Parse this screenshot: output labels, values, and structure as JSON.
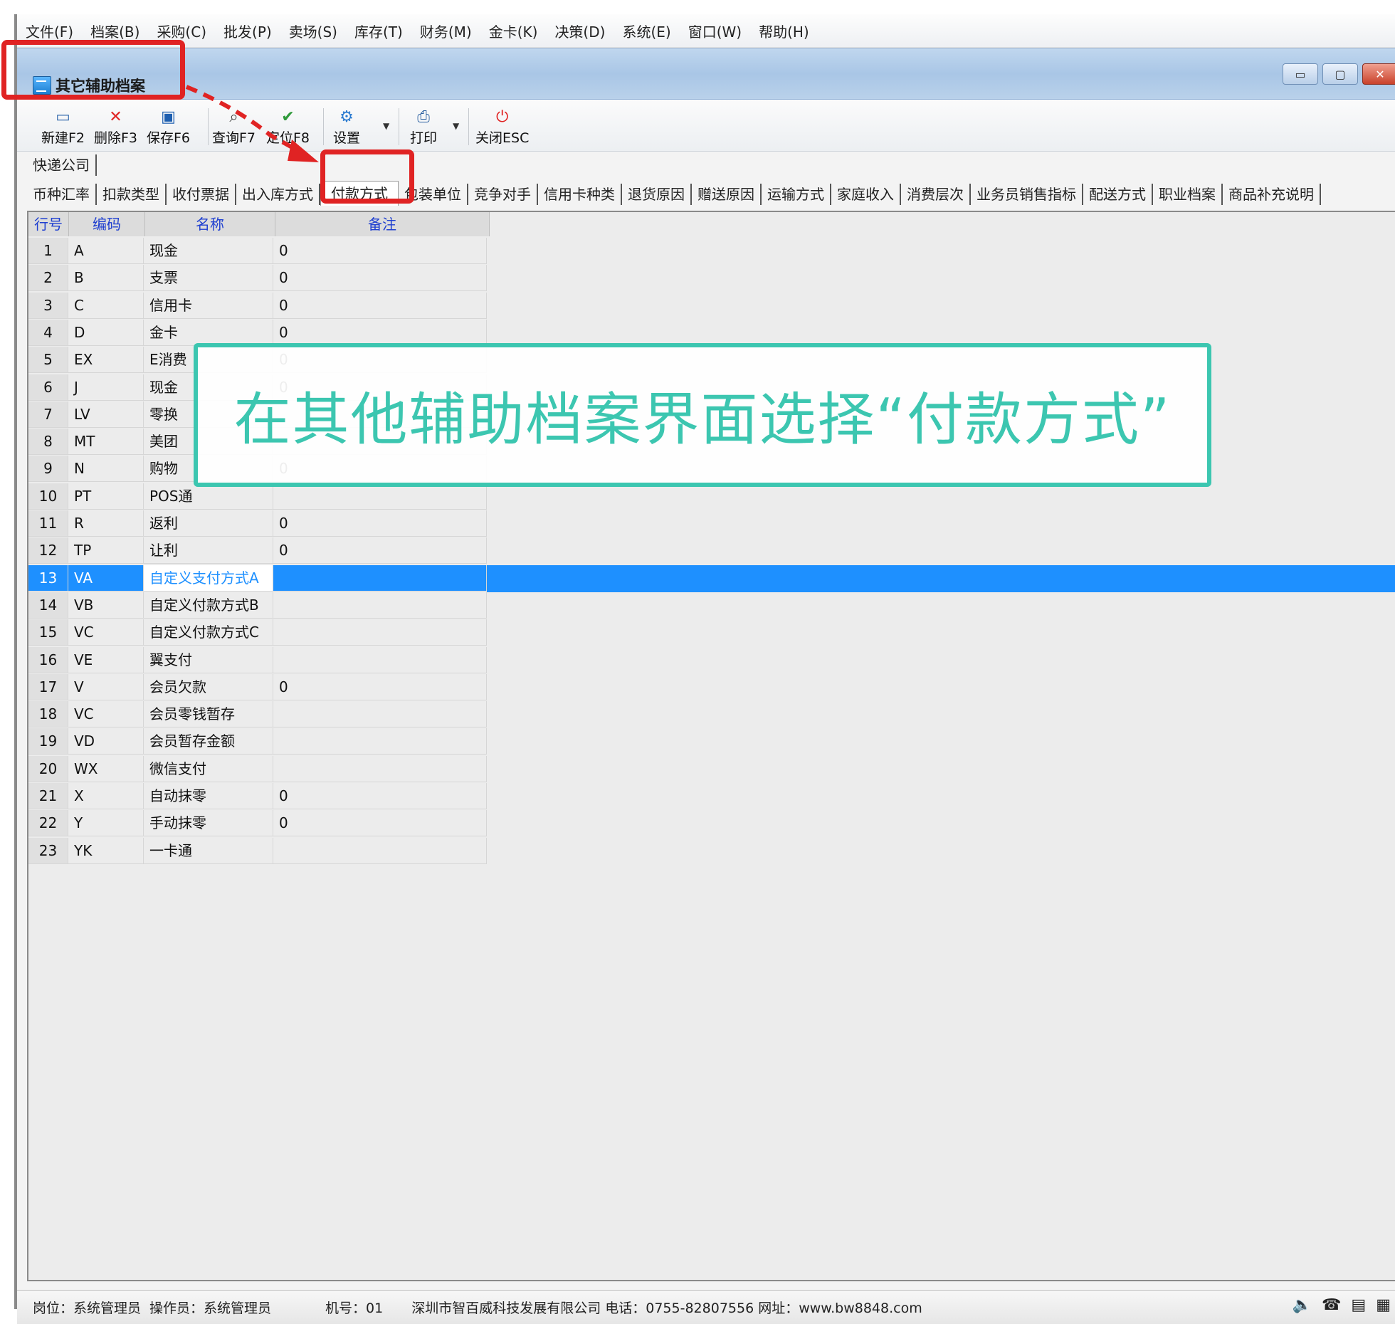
{
  "menubar": {
    "items": [
      "文件(F)",
      "档案(B)",
      "采购(C)",
      "批发(P)",
      "卖场(S)",
      "库存(T)",
      "财务(M)",
      "金卡(K)",
      "决策(D)",
      "系统(E)",
      "窗口(W)",
      "帮助(H)"
    ]
  },
  "window": {
    "title": "其它辅助档案",
    "minimize_icon": "minimize-icon",
    "maximize_icon": "maximize-icon",
    "close_icon": "close-icon"
  },
  "toolbar": {
    "new_label": "新建F2",
    "delete_label": "删除F3",
    "save_label": "保存F6",
    "query_label": "查询F7",
    "locate_label": "定位F8",
    "settings_label": "设置",
    "print_label": "打印",
    "close_label": "关闭ESC"
  },
  "tabs_row1": [
    "快递公司"
  ],
  "tabs_row2": [
    "币种汇率",
    "扣款类型",
    "收付票据",
    "出入库方式",
    "付款方式",
    "包装单位",
    "竞争对手",
    "信用卡种类",
    "退货原因",
    "赠送原因",
    "运输方式",
    "家庭收入",
    "消费层次",
    "业务员销售指标",
    "配送方式",
    "职业档案",
    "商品补充说明"
  ],
  "active_tab": "付款方式",
  "grid": {
    "headers": {
      "row_no": "行号",
      "code": "编码",
      "name": "名称",
      "note": "备注"
    },
    "rows": [
      {
        "no": "1",
        "code": "A",
        "name": "现金",
        "note": "0"
      },
      {
        "no": "2",
        "code": "B",
        "name": "支票",
        "note": "0"
      },
      {
        "no": "3",
        "code": "C",
        "name": "信用卡",
        "note": "0"
      },
      {
        "no": "4",
        "code": "D",
        "name": "金卡",
        "note": "0"
      },
      {
        "no": "5",
        "code": "EX",
        "name": "E消费",
        "note": "0"
      },
      {
        "no": "6",
        "code": "J",
        "name": "现金",
        "note": "0"
      },
      {
        "no": "7",
        "code": "LV",
        "name": "零换",
        "note": ""
      },
      {
        "no": "8",
        "code": "MT",
        "name": "美团",
        "note": ""
      },
      {
        "no": "9",
        "code": "N",
        "name": "购物",
        "note": "0"
      },
      {
        "no": "10",
        "code": "PT",
        "name": "POS通",
        "note": ""
      },
      {
        "no": "11",
        "code": "R",
        "name": "返利",
        "note": "0"
      },
      {
        "no": "12",
        "code": "TP",
        "name": "让利",
        "note": "0"
      },
      {
        "no": "13",
        "code": "VA",
        "name": "自定义支付方式A",
        "note": ""
      },
      {
        "no": "14",
        "code": "VB",
        "name": "自定义付款方式B",
        "note": ""
      },
      {
        "no": "15",
        "code": "VC",
        "name": "自定义付款方式C",
        "note": ""
      },
      {
        "no": "16",
        "code": "VE",
        "name": "翼支付",
        "note": ""
      },
      {
        "no": "17",
        "code": "V",
        "name": "会员欠款",
        "note": "0"
      },
      {
        "no": "18",
        "code": "VC",
        "name": "会员零钱暂存",
        "note": ""
      },
      {
        "no": "19",
        "code": "VD",
        "name": "会员暂存金额",
        "note": ""
      },
      {
        "no": "20",
        "code": "WX",
        "name": "微信支付",
        "note": ""
      },
      {
        "no": "21",
        "code": "X",
        "name": "自动抹零",
        "note": "0"
      },
      {
        "no": "22",
        "code": "Y",
        "name": "手动抹零",
        "note": "0"
      },
      {
        "no": "23",
        "code": "YK",
        "name": "一卡通",
        "note": ""
      }
    ],
    "selected_row": 13
  },
  "callout": {
    "text": "在其他辅助档案界面选择“付款方式”"
  },
  "statusbar": {
    "position": "岗位：系统管理员",
    "operator": "操作员：系统管理员",
    "machine": "机号：01",
    "company": "深圳市智百威科技发展有限公司 电话：0755-82807556 网址：www.bw8848.com"
  },
  "colors": {
    "accent": "#1e90ff",
    "highlight": "#e02323",
    "callout": "#3cc6b0"
  }
}
